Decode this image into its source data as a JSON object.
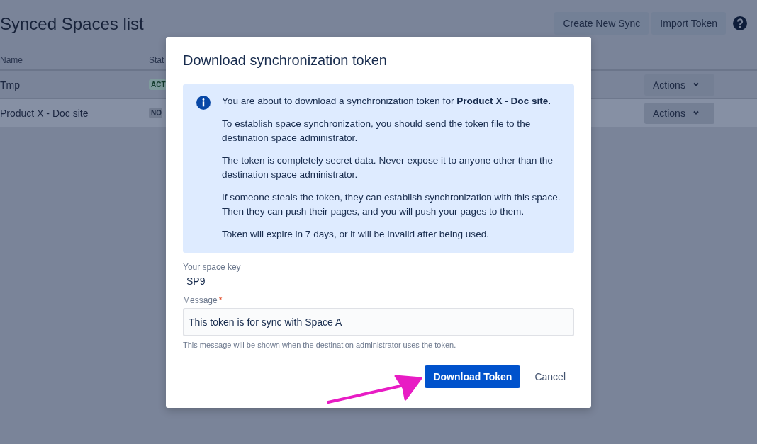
{
  "page": {
    "title": "Synced Spaces list",
    "buttons": [
      "Create New Sync",
      "Import Token"
    ]
  },
  "table": {
    "columns": [
      "Name",
      "Stat"
    ],
    "rows": [
      {
        "name": "Tmp",
        "status": "ACT",
        "kind": "success",
        "action": "Actions",
        "hovered": false
      },
      {
        "name": "Product X - Doc site",
        "status": "NO",
        "kind": "default",
        "action": "Actions",
        "hovered": true
      }
    ]
  },
  "dialog": {
    "title": "Download synchronization token",
    "info": [
      "You are about to download a synchronization token for **Product X - Doc site**.",
      "To establish space synchronization, you should send the token file to the destination space administrator.",
      "The token is completely secret data. Never expose it to anyone other than the destination space administrator.",
      "If someone steals the token, they can establish synchronization with this space. Then they can push their pages, and you will push your pages to them.",
      "Token will expire in 7 days, or it will be invalid after being used."
    ],
    "space_key": {
      "label": "Your space key",
      "value": "SP9"
    },
    "message": {
      "label": "Message",
      "required_mark": "*",
      "value": "This token is for sync with Space A",
      "help": "This message will be shown when the destination administrator uses the token."
    },
    "primary_button": "Download Token",
    "secondary_button": "Cancel"
  }
}
